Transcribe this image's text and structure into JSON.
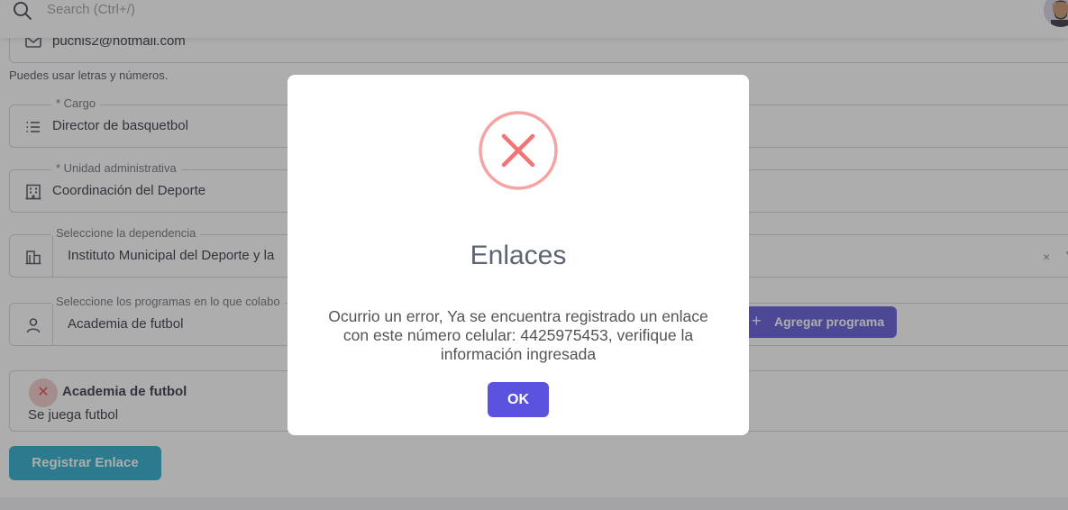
{
  "topbar": {
    "search_placeholder": "Search (Ctrl+/)"
  },
  "form": {
    "email": {
      "value": "puchis2@hotmail.com"
    },
    "hint": "Puedes usar letras y números.",
    "cargo": {
      "label": "* Cargo",
      "value": "Director de basquetbol"
    },
    "unidad": {
      "label": "* Unidad administrativa",
      "value": "Coordinación del Deporte"
    },
    "dependencia": {
      "label": "Seleccione la dependencia",
      "value": "Instituto Municipal del Deporte y la",
      "clear": "×",
      "caret": "▼"
    },
    "programas": {
      "label": "Seleccione los programas en lo que colabo",
      "value": "Academia de futbol"
    },
    "add_button": {
      "plus": "+",
      "label": "Agregar programa"
    },
    "program_card": {
      "remove": "✕",
      "title": "Academia de futbol",
      "description": "Se juega futbol"
    },
    "submit_label": "Registrar Enlace"
  },
  "modal": {
    "title": "Enlaces",
    "message": "Ocurrio un error, Ya se encuentra registrado un enlace con este número celular: 4425975453, verifique la información ingresada",
    "ok_label": "OK",
    "icon": "error-x-icon"
  },
  "colors": {
    "primary": "#5b52d6",
    "submit": "#1fa8c9",
    "error": "#f27474"
  }
}
